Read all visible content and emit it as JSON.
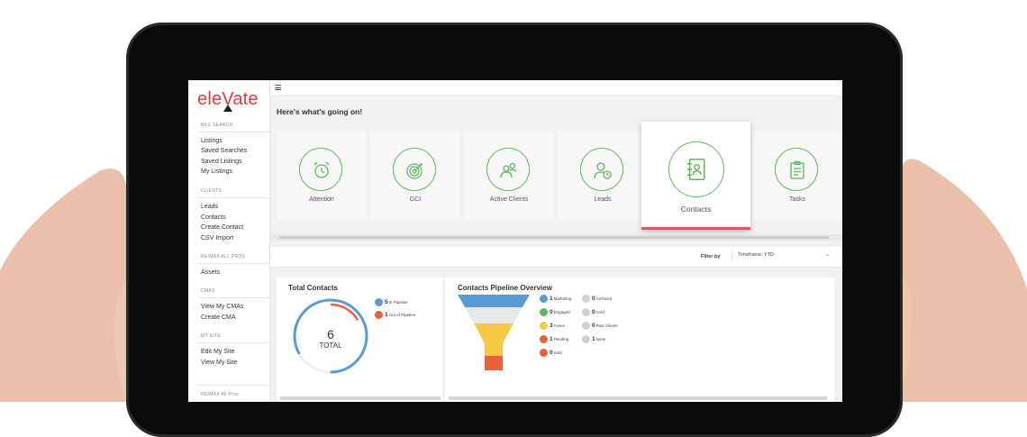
{
  "sidebar": {
    "logo": "eleVate",
    "sections": [
      {
        "heading": "MLS SEARCH",
        "items": [
          "Listings",
          "Saved Searches",
          "Saved Listings",
          "My Listings"
        ]
      },
      {
        "heading": "CLIENTS",
        "items": [
          "Leads",
          "Contacts",
          "Create Contact",
          "CSV Import"
        ]
      },
      {
        "heading": "RE/MAX ALL PROS",
        "items": [
          "Assets"
        ]
      },
      {
        "heading": "CMAS",
        "items": [
          "View My CMAs",
          "Create CMA"
        ]
      },
      {
        "heading": "MY SITE",
        "items": [
          "Edit My Site",
          "View My Site"
        ]
      }
    ],
    "footer": "RE/MAX All Pros"
  },
  "header": {
    "menu_icon": "hamburger-icon",
    "title": "Here's what's going on!"
  },
  "cards": [
    {
      "label": "Attention",
      "icon": "alarm-clock-icon",
      "active": false
    },
    {
      "label": "GCI",
      "icon": "target-icon",
      "active": false
    },
    {
      "label": "Active Clients",
      "icon": "people-icon",
      "active": false
    },
    {
      "label": "Leads",
      "icon": "user-clock-icon",
      "active": false
    },
    {
      "label": "Contacts",
      "icon": "contact-book-icon",
      "active": true
    },
    {
      "label": "Tasks",
      "icon": "clipboard-icon",
      "active": false
    }
  ],
  "filter": {
    "label": "Filter by",
    "value": "Timeframe: YTD"
  },
  "total_contacts": {
    "title": "Total Contacts",
    "total": "6",
    "total_label": "TOTAL",
    "legend": [
      {
        "count": "5",
        "label": "In Pipeline",
        "color": "#5b9bd5"
      },
      {
        "count": "1",
        "label": "Out of Pipeline",
        "color": "#e8603c"
      }
    ]
  },
  "pipeline": {
    "title": "Contacts Pipeline Overview",
    "stages_left": [
      {
        "count": "1",
        "label": "Marketing",
        "color": "#5b9bd5"
      },
      {
        "count": "0",
        "label": "Engaged",
        "color": "#5cb85c"
      },
      {
        "count": "3",
        "label": "Active",
        "color": "#f5c842"
      },
      {
        "count": "1",
        "label": "Pending",
        "color": "#e8603c"
      },
      {
        "count": "0",
        "label": "Sold",
        "color": "#e8603c"
      }
    ],
    "stages_right": [
      {
        "count": "0",
        "label": "Archived",
        "color": "#d0d0d0"
      },
      {
        "count": "0",
        "label": "Cold",
        "color": "#d0d0d0"
      },
      {
        "count": "0",
        "label": "Past Clients",
        "color": "#d0d0d0"
      },
      {
        "count": "1",
        "label": "None",
        "color": "#d0d0d0"
      }
    ]
  },
  "colors": {
    "brand": "#e03a3e",
    "accent_green": "#5cb85c",
    "active_bar": "#e05a5a"
  }
}
